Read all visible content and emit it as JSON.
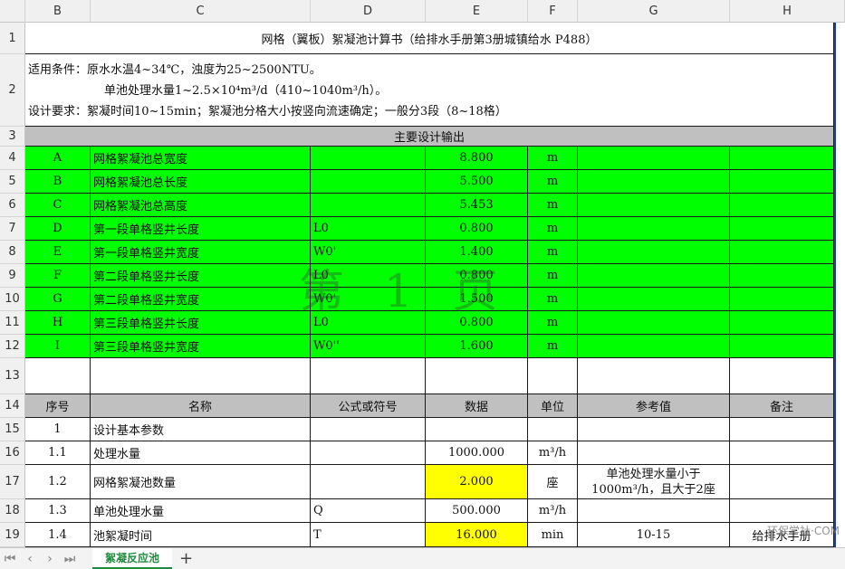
{
  "columns": [
    "B",
    "C",
    "D",
    "E",
    "F",
    "G",
    "H"
  ],
  "rows": [
    "1",
    "2",
    "3",
    "4",
    "5",
    "6",
    "7",
    "8",
    "9",
    "10",
    "11",
    "12",
    "13",
    "14",
    "15",
    "16",
    "17",
    "18",
    "19"
  ],
  "title": "网格（翼板）絮凝池计算书（给排水手册第3册城镇给水 P488）",
  "conditions": {
    "line1": "适用条件：原水水温4~34℃，浊度为25~2500NTU。",
    "line2": "单池处理水量1~2.5×10⁴m³/d（410~1040m³/h）。",
    "line3": "设计要求：絮凝时间10~15min；絮凝池分格大小按竖向流速确定；一般分3段（8~18格）"
  },
  "output_header": "主要设计输出",
  "outputs": [
    {
      "id": "A",
      "name": "网格絮凝池总宽度",
      "symbol": "",
      "value": "8.800",
      "unit": "m"
    },
    {
      "id": "B",
      "name": "网格絮凝池总长度",
      "symbol": "",
      "value": "5.500",
      "unit": "m"
    },
    {
      "id": "C",
      "name": "网格絮凝池总高度",
      "symbol": "",
      "value": "5.453",
      "unit": "m"
    },
    {
      "id": "D",
      "name": "第一段单格竖井长度",
      "symbol": "L0",
      "value": "0.800",
      "unit": "m"
    },
    {
      "id": "E",
      "name": "第一段单格竖井宽度",
      "symbol": "W0'",
      "value": "1.400",
      "unit": "m"
    },
    {
      "id": "F",
      "name": "第二段单格竖井长度",
      "symbol": "L0",
      "value": "0.800",
      "unit": "m"
    },
    {
      "id": "G",
      "name": "第二段单格竖井宽度",
      "symbol": "W0'",
      "value": "1.500",
      "unit": "m"
    },
    {
      "id": "H",
      "name": "第三段单格竖井长度",
      "symbol": "L0",
      "value": "0.800",
      "unit": "m"
    },
    {
      "id": "I",
      "name": "第三段单格竖井宽度",
      "symbol": "W0''",
      "value": "1.600",
      "unit": "m"
    }
  ],
  "table_header": {
    "seq": "序号",
    "name": "名称",
    "formula": "公式或符号",
    "data": "数据",
    "unit": "单位",
    "ref": "参考值",
    "note": "备注"
  },
  "params": [
    {
      "seq": "1",
      "name": "设计基本参数",
      "formula": "",
      "data": "",
      "unit": "",
      "ref": "",
      "note": ""
    },
    {
      "seq": "1.1",
      "name": "处理水量",
      "formula": "",
      "data": "1000.000",
      "unit": "m³/h",
      "ref": "",
      "note": ""
    },
    {
      "seq": "1.2",
      "name": "网格絮凝池数量",
      "formula": "",
      "data": "2.000",
      "unit": "座",
      "ref": "单池处理水量小于1000m³/h，且大于2座",
      "note": ""
    },
    {
      "seq": "1.3",
      "name": "单池处理水量",
      "formula": "Q",
      "data": "500.000",
      "unit": "m³/h",
      "ref": "",
      "note": ""
    },
    {
      "seq": "1.4",
      "name": "池絮凝时间",
      "formula": "T",
      "data": "16.000",
      "unit": "min",
      "ref": "10-15",
      "note": "给排水手册"
    }
  ],
  "watermark": "第 1 页",
  "sheet_tab": "絮凝反应池",
  "site_logo": "环保学社·COM",
  "colors": {
    "green": "#00ff00",
    "gray": "#c0c0c0",
    "yellow": "#ffff00",
    "selection": "#1b3cc7"
  }
}
